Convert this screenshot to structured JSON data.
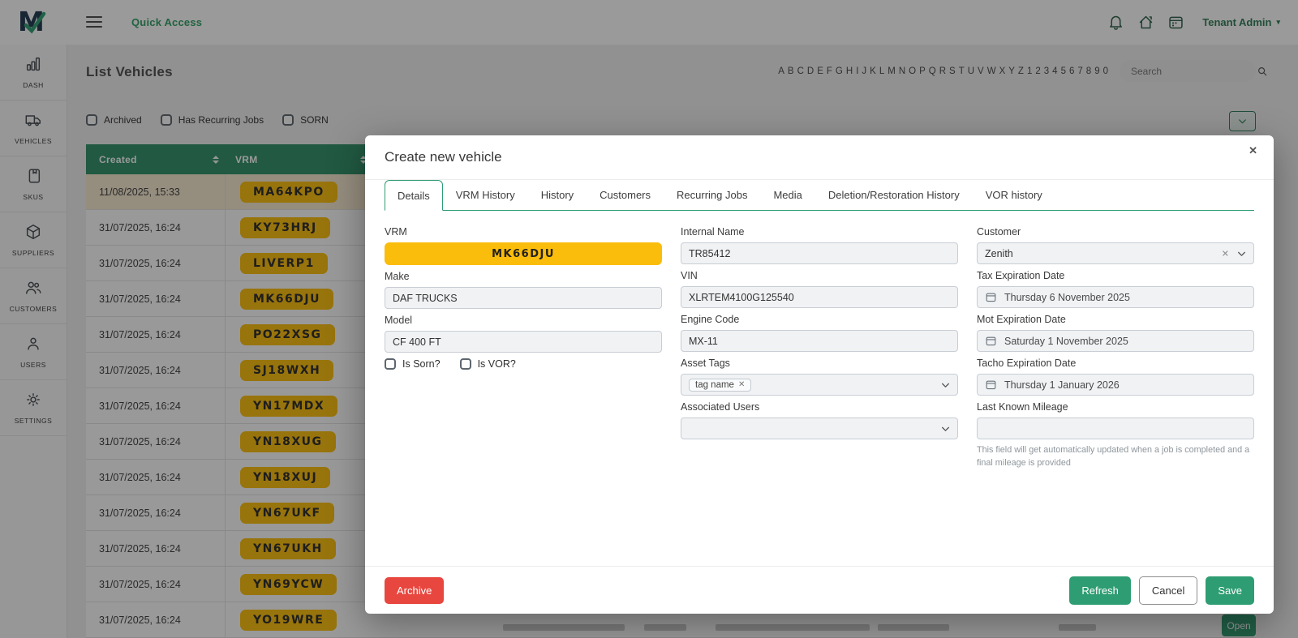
{
  "colors": {
    "brand_green": "#2f9d73",
    "table_header_green": "#2f8f68",
    "plate_yellow": "#fbbd0b",
    "archive_red": "#e8473f",
    "link_green": "#2fa065",
    "warning_red": "#d64541"
  },
  "topbar": {
    "logo_letter": "M",
    "quick_access": "Quick Access",
    "user_menu": "Tenant Admin",
    "caret": "▾"
  },
  "sidebar": {
    "items": [
      {
        "id": "dash",
        "label": "DASH",
        "icon": "bar-chart-icon"
      },
      {
        "id": "vehicles",
        "label": "VEHICLES",
        "icon": "truck-icon"
      },
      {
        "id": "skus",
        "label": "SKUS",
        "icon": "notebook-icon"
      },
      {
        "id": "suppliers",
        "label": "SUPPLIERS",
        "icon": "box-icon"
      },
      {
        "id": "customers",
        "label": "CUSTOMERS",
        "icon": "people-icon"
      },
      {
        "id": "users",
        "label": "USERS",
        "icon": "person-icon"
      },
      {
        "id": "settings",
        "label": "SETTINGS",
        "icon": "gear-icon"
      }
    ]
  },
  "page": {
    "title": "List Vehicles",
    "alphabet": [
      "A",
      "B",
      "C",
      "D",
      "E",
      "F",
      "G",
      "H",
      "I",
      "J",
      "K",
      "L",
      "M",
      "N",
      "O",
      "P",
      "Q",
      "R",
      "S",
      "T",
      "U",
      "V",
      "W",
      "X",
      "Y",
      "Z",
      "1",
      "2",
      "3",
      "4",
      "5",
      "6",
      "7",
      "8",
      "9",
      "0"
    ],
    "search": {
      "placeholder": "Search"
    },
    "filters": [
      {
        "label": "Archived",
        "checked": false
      },
      {
        "label": "Has Recurring Jobs",
        "checked": false
      },
      {
        "label": "SORN",
        "checked": false
      }
    ],
    "table": {
      "columns": [
        {
          "label": "Created"
        },
        {
          "label": "VRM"
        }
      ],
      "rows": [
        {
          "created": "11/08/2025, 15:33",
          "vrm": "MA64KPO",
          "warning": true,
          "highlighted": true
        },
        {
          "created": "31/07/2025, 16:24",
          "vrm": "KY73HRJ"
        },
        {
          "created": "31/07/2025, 16:24",
          "vrm": "LIVERP1"
        },
        {
          "created": "31/07/2025, 16:24",
          "vrm": "MK66DJU"
        },
        {
          "created": "31/07/2025, 16:24",
          "vrm": "PO22XSG"
        },
        {
          "created": "31/07/2025, 16:24",
          "vrm": "SJ18WXH"
        },
        {
          "created": "31/07/2025, 16:24",
          "vrm": "YN17MDX"
        },
        {
          "created": "31/07/2025, 16:24",
          "vrm": "YN18XUG"
        },
        {
          "created": "31/07/2025, 16:24",
          "vrm": "YN18XUJ"
        },
        {
          "created": "31/07/2025, 16:24",
          "vrm": "YN67UKF"
        },
        {
          "created": "31/07/2025, 16:24",
          "vrm": "YN67UKH"
        },
        {
          "created": "31/07/2025, 16:24",
          "vrm": "YN69YCW"
        },
        {
          "created": "31/07/2025, 16:24",
          "vrm": "YO19WRE"
        }
      ],
      "partial_row_action": "Open"
    }
  },
  "modal": {
    "title": "Create new vehicle",
    "close_glyph": "✕",
    "tabs": [
      {
        "label": "Details",
        "active": true
      },
      {
        "label": "VRM History"
      },
      {
        "label": "History"
      },
      {
        "label": "Customers"
      },
      {
        "label": "Recurring Jobs"
      },
      {
        "label": "Media"
      },
      {
        "label": "Deletion/Restoration History"
      },
      {
        "label": "VOR history"
      }
    ],
    "form": {
      "vrm": {
        "label": "VRM",
        "value": "MK66DJU"
      },
      "make": {
        "label": "Make",
        "value": "DAF TRUCKS"
      },
      "model": {
        "label": "Model",
        "value": "CF 400 FT"
      },
      "is_sorn": {
        "label": "Is Sorn?",
        "checked": false
      },
      "is_vor": {
        "label": "Is VOR?",
        "checked": false
      },
      "internal_name": {
        "label": "Internal Name",
        "value": "TR85412"
      },
      "vin": {
        "label": "VIN",
        "value": "XLRTEM4100G125540"
      },
      "engine_code": {
        "label": "Engine Code",
        "value": "MX-11"
      },
      "asset_tags": {
        "label": "Asset Tags",
        "chip": "tag name",
        "chip_remove_glyph": "✕"
      },
      "associated_users": {
        "label": "Associated Users",
        "value": ""
      },
      "customer": {
        "label": "Customer",
        "value": "Zenith",
        "clear_glyph": "✕"
      },
      "tax_expiration_date": {
        "label": "Tax Expiration Date",
        "value": "Thursday 6 November 2025"
      },
      "mot_expiration_date": {
        "label": "Mot Expiration Date",
        "value": "Saturday 1 November 2025"
      },
      "tacho_expiration_date": {
        "label": "Tacho Expiration Date",
        "value": "Thursday 1 January 2026"
      },
      "last_known_mileage": {
        "label": "Last Known Mileage",
        "value": "",
        "hint": "This field will get automatically updated when a job is completed and a final mileage is provided"
      }
    },
    "footer": {
      "archive": "Archive",
      "refresh": "Refresh",
      "cancel": "Cancel",
      "save": "Save"
    }
  }
}
